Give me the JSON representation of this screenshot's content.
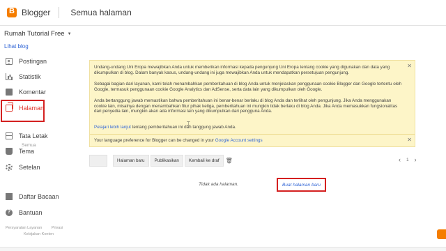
{
  "header": {
    "brand": "Blogger",
    "page_title": "Semua halaman"
  },
  "sidebar": {
    "blog_name": "Rumah Tutorial Free",
    "view_blog": "Lihat blog",
    "items": [
      {
        "label": "Postingan",
        "icon": "posts-icon"
      },
      {
        "label": "Statistik",
        "icon": "stats-icon"
      },
      {
        "label": "Komentar",
        "icon": "comments-icon"
      },
      {
        "label": "Halaman",
        "icon": "pages-icon",
        "active": true
      },
      {
        "label": "Tata Letak",
        "icon": "layout-icon"
      },
      {
        "label": "Tema",
        "icon": "theme-icon"
      },
      {
        "label": "Setelan",
        "icon": "settings-icon"
      },
      {
        "label": "Daftar Bacaan",
        "icon": "reading-list-icon"
      },
      {
        "label": "Bantuan",
        "icon": "help-icon"
      }
    ],
    "subitem": "Semua",
    "footer": [
      "Persyaratan Layanan",
      "Privasi",
      "Kebijakan Konten"
    ]
  },
  "notice": {
    "p1": "Undang-undang Uni Eropa mewajibkan Anda untuk memberikan informasi kepada pengunjung Uni Eropa tentang cookie yang digunakan dan data yang dikumpulkan di blog. Dalam banyak kasus, undang-undang ini juga mewajibkan Anda untuk mendapatkan persetujuan pengunjung.",
    "p2": "Sebagai bagian dari layanan, kami telah menambahkan pemberitahuan di blog Anda untuk menjelaskan penggunaan cookie Blogger dan Google tertentu oleh Google, termasuk penggunaan cookie Google Analytics dan AdSense, serta data lain yang dikumpulkan oleh Google.",
    "p3": "Anda bertanggung jawab memastikan bahwa pemberitahuan ini benar-benar berlaku di blog Anda dan terlihat oleh pengunjung. Jika Anda menggunakan cookie lain, misalnya dengan menambahkan fitur pihak ketiga, pemberitahuan ini mungkin tidak berlaku di blog Anda. Jika Anda memasukkan fungsionalitas dari penyedia lain, mungkin akan ada informasi lain yang dikumpulkan dari pengguna Anda.",
    "learn_link": "Pelajari lebih lanjut",
    "learn_rest": " tentang pemberitahuan ini dan tanggung jawab Anda.",
    "close": "✕",
    "lang_text": "Your language preference for Blogger can be changed in your ",
    "lang_link": "Google Account settings",
    "lang_close": "✕"
  },
  "toolbar": {
    "new_page": "Halaman baru",
    "publish": "Publikasikan",
    "revert": "Kembali ke draf"
  },
  "pager": {
    "page": "1",
    "prev": "‹",
    "next": "›"
  },
  "empty": {
    "message": "Tidak ada halaman.",
    "create_link": "Buat halaman baru"
  },
  "colors": {
    "accent": "#f57d00",
    "active": "#e0352b",
    "highlight": "#d42020",
    "link": "#3367d6",
    "notice_bg": "#fdf5c8"
  }
}
